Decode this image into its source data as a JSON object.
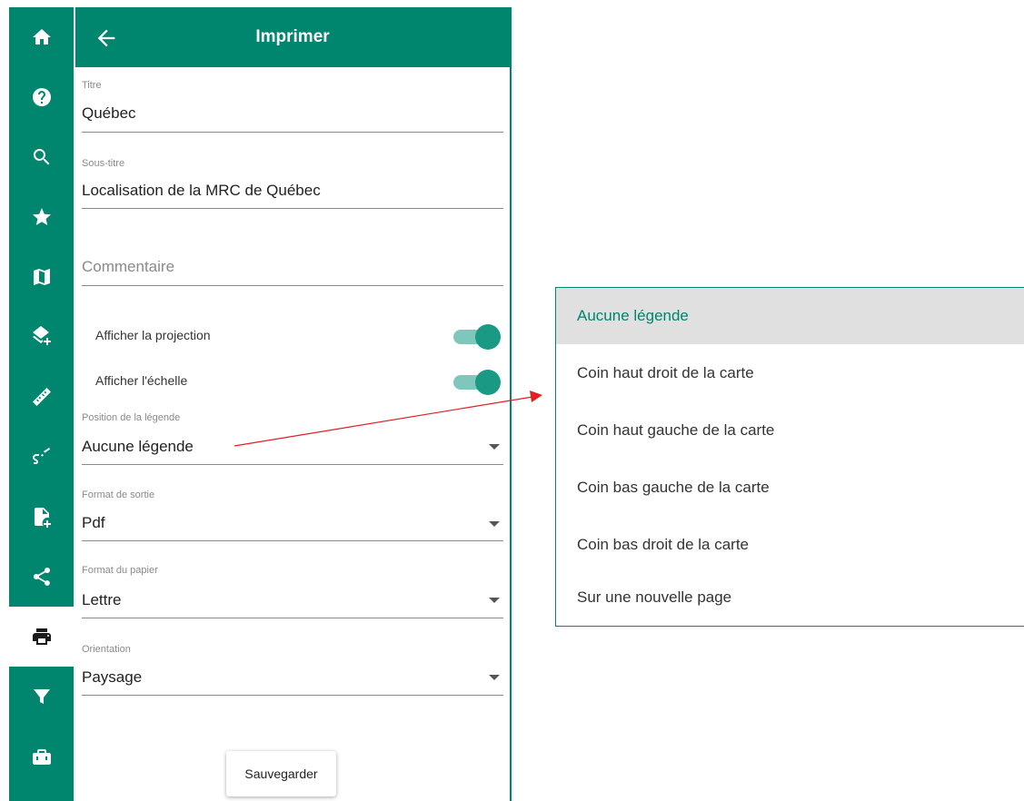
{
  "panel": {
    "title": "Imprimer",
    "fields": {
      "titre": {
        "label": "Titre",
        "value": "Québec"
      },
      "sous_titre": {
        "label": "Sous-titre",
        "value": "Localisation de la MRC de Québec"
      },
      "commentaire": {
        "placeholder": "Commentaire",
        "value": ""
      },
      "position_legende": {
        "label": "Position de la légende",
        "value": "Aucune légende"
      },
      "format_sortie": {
        "label": "Format de sortie",
        "value": "Pdf"
      },
      "format_papier": {
        "label": "Format du papier",
        "value": "Lettre"
      },
      "orientation": {
        "label": "Orientation",
        "value": "Paysage"
      }
    },
    "toggles": {
      "projection": {
        "label": "Afficher la projection",
        "on": true
      },
      "echelle": {
        "label": "Afficher l'échelle",
        "on": true
      }
    },
    "save_label": "Sauvegarder"
  },
  "rail": {
    "icons": [
      "home-icon",
      "help-icon",
      "search-icon",
      "star-icon",
      "map-icon",
      "layers-add-icon",
      "ruler-icon",
      "route-icon",
      "file-import-icon",
      "share-icon",
      "print-icon",
      "filter-icon",
      "toolbox-icon"
    ],
    "active": "print-icon"
  },
  "dropdown": {
    "options": [
      {
        "label": "Aucune légende",
        "selected": true
      },
      {
        "label": "Coin haut droit de la carte",
        "selected": false
      },
      {
        "label": "Coin haut gauche de la carte",
        "selected": false
      },
      {
        "label": "Coin bas gauche de la carte",
        "selected": false
      },
      {
        "label": "Coin bas droit de la carte",
        "selected": false
      },
      {
        "label": "Sur une nouvelle page",
        "selected": false
      }
    ]
  },
  "colors": {
    "primary": "#00856f",
    "toggle_track": "#7fc7bb",
    "toggle_thumb": "#1a9a85",
    "annotation_arrow": "#e02020",
    "selected_bg": "#e0e0e0"
  }
}
